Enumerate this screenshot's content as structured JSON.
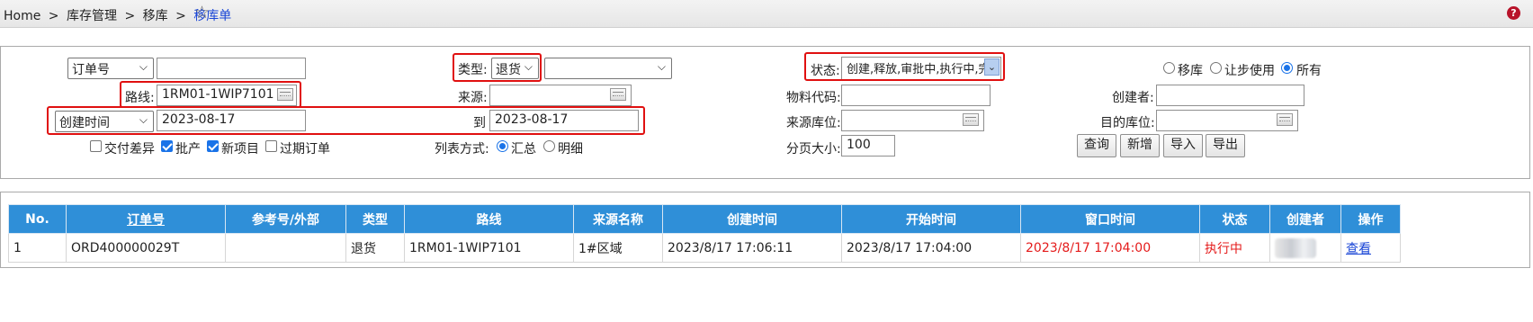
{
  "breadcrumb": {
    "items": [
      "Home",
      "库存管理",
      "移库",
      "移库单"
    ],
    "separator": ">"
  },
  "filters": {
    "order_field_select": "订单号",
    "order_value": "",
    "type_label": "类型:",
    "type_select": "退货",
    "type_sub_select": "",
    "status_label": "状态:",
    "status_value": "创建,释放,审批中,执行中,完",
    "mode_options": [
      "移库",
      "让步使用",
      "所有"
    ],
    "mode_selected": "所有",
    "route_label": "路线:",
    "route_value": "1RM01-1WIP7101",
    "source_label": "来源:",
    "source_value": "",
    "material_label": "物料代码:",
    "material_value": "",
    "creator_label": "创建者:",
    "creator_value": "",
    "date_field_select": "创建时间",
    "date_from": "2023-08-17",
    "to_label": "到",
    "date_to": "2023-08-17",
    "source_loc_label": "来源库位:",
    "source_loc_value": "",
    "dest_loc_label": "目的库位:",
    "dest_loc_value": "",
    "checkboxes": [
      {
        "label": "交付差异",
        "checked": false
      },
      {
        "label": "批产",
        "checked": true
      },
      {
        "label": "新项目",
        "checked": true
      },
      {
        "label": "过期订单",
        "checked": false
      }
    ],
    "list_mode_label": "列表方式:",
    "list_mode_options": [
      "汇总",
      "明细"
    ],
    "list_mode_selected": "汇总",
    "page_size_label": "分页大小:",
    "page_size": "100",
    "buttons": [
      "查询",
      "新增",
      "导入",
      "导出"
    ]
  },
  "table": {
    "columns": [
      "No.",
      "订单号",
      "参考号/外部",
      "类型",
      "路线",
      "来源名称",
      "创建时间",
      "开始时间",
      "窗口时间",
      "状态",
      "创建者",
      "操作"
    ],
    "rows": [
      {
        "no": "1",
        "order_no": "ORD400000029T",
        "ref": "",
        "type": "退货",
        "route": "1RM01-1WIP7101",
        "source_name": "1#区域",
        "created": "2023/8/17 17:06:11",
        "start": "2023/8/17 17:04:00",
        "window": "2023/8/17 17:04:00",
        "status": "执行中",
        "creator": "",
        "action": "查看"
      }
    ]
  },
  "colors": {
    "header_blue": "#2f8fd8",
    "highlight_red": "#e01010",
    "alert_text_red": "#e41b1b",
    "link_blue": "#1a46d6"
  }
}
